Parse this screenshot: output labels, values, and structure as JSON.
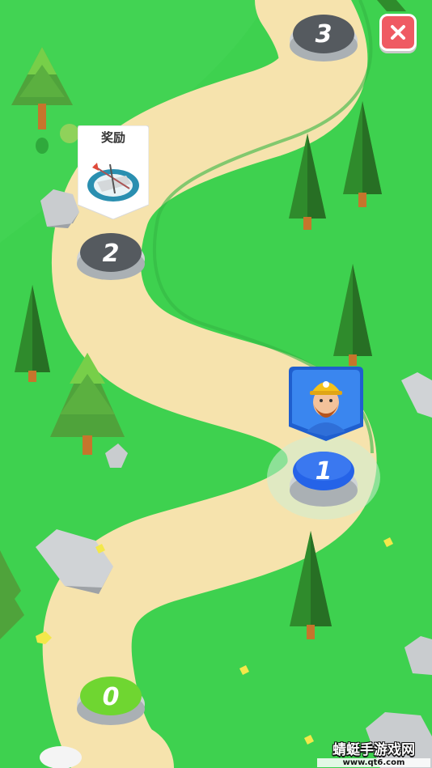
{
  "levels": [
    {
      "label": "0",
      "state": "current-green"
    },
    {
      "label": "1",
      "state": "selected-blue"
    },
    {
      "label": "2",
      "state": "locked-gray"
    },
    {
      "label": "3",
      "state": "locked-gray"
    }
  ],
  "reward": {
    "title": "奖励"
  },
  "close_icon": "close-icon",
  "watermark": {
    "text": "蜻蜓手游戏网",
    "url": "www.qt6.com"
  },
  "colors": {
    "grass": "#3ed14f",
    "path": "#f6e3ad",
    "node_green": "#6fd631",
    "node_blue": "#2563e8",
    "node_gray": "#555a5f",
    "close": "#ef5a63"
  }
}
